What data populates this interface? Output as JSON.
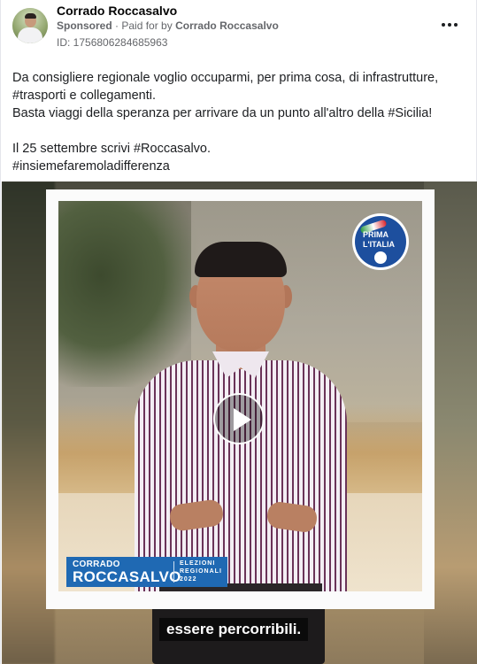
{
  "post": {
    "page_name": "Corrado Roccasalvo",
    "sponsored_label": "Sponsored",
    "separator": "·",
    "paid_for_prefix": "Paid for by",
    "paid_for_by": "Corrado Roccasalvo",
    "ad_id": "ID: 1756806284685963",
    "more_icon": "more-horizontal-icon"
  },
  "body_text": {
    "line1": "Da consigliere regionale voglio occuparmi, per prima cosa, di infrastrutture,",
    "line2": "#trasporti e collegamenti.",
    "line3": "Basta viaggi della speranza per arrivare da un punto all'altro della #Sicilia!",
    "line4": "Il 25 settembre scrivi #Roccasalvo.",
    "line5": "#insiemefaremoladifferenza"
  },
  "video": {
    "logo_line1": "PRIMA",
    "logo_line2": "L'ITALIA",
    "banner_first": "CORRADO",
    "banner_last": "ROCCASALVO",
    "banner_el1": "ELEZIONI",
    "banner_el2": "REGIONALI",
    "banner_el3": "2022",
    "caption": "essere percorribili.",
    "play_icon": "play-icon"
  },
  "colors": {
    "banner_blue": "#1f69b3",
    "logo_blue": "#1d4f9e",
    "text_primary": "#1c1e21",
    "text_secondary": "#65676b"
  }
}
